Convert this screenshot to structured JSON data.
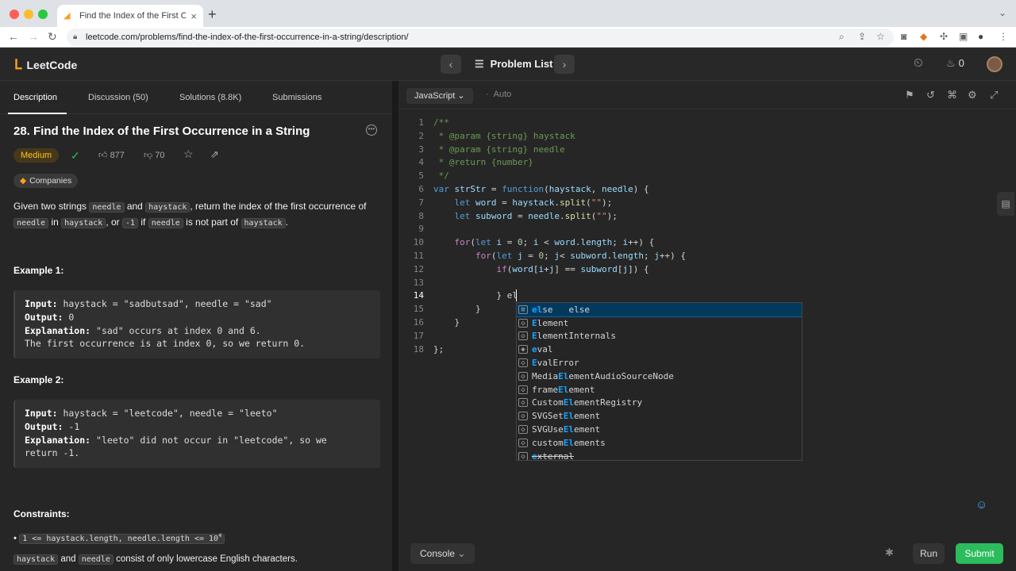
{
  "browser": {
    "tab_title": "Find the Index of the First Occu",
    "url": "leetcode.com/problems/find-the-index-of-the-first-occurrence-in-a-string/description/",
    "traffic_colors": [
      "#ff5f57",
      "#febc2e",
      "#28c840"
    ]
  },
  "nav": {
    "logo": "LeetCode",
    "problem_list": "Problem List",
    "streak": "0"
  },
  "left_tabs": [
    "Description",
    "Discussion (50)",
    "Solutions (8.8K)",
    "Submissions"
  ],
  "problem": {
    "title": "28. Find the Index of the First Occurrence in a String",
    "difficulty": "Medium",
    "likes": "877",
    "dislikes": "70",
    "companies": "Companies",
    "desc": {
      "p1": "Given two strings ",
      "c1": "needle",
      "p2": " and ",
      "c2": "haystack",
      "p3": ", return the index of the first occurrence of",
      "c3": "needle",
      "p4": " in ",
      "c4": "haystack",
      "p5": ", or ",
      "c5": "-1",
      "p6": " if ",
      "c6": "needle",
      "p7": " is not part of ",
      "c7": "haystack",
      "p8": "."
    },
    "example1_heading": "Example 1:",
    "example1": {
      "input_label": "Input:",
      "input": " haystack = \"sadbutsad\", needle = \"sad\"",
      "output_label": "Output:",
      "output": " 0",
      "expl_label": "Explanation:",
      "expl": " \"sad\" occurs at index 0 and 6.",
      "expl2": "The first occurrence is at index 0, so we return 0."
    },
    "example2_heading": "Example 2:",
    "example2": {
      "input_label": "Input:",
      "input": " haystack = \"leetcode\", needle = \"leeto\"",
      "output_label": "Output:",
      "output": " -1",
      "expl_label": "Explanation:",
      "expl": " \"leeto\" did not occur in \"leetcode\", so we",
      "expl2": "return -1."
    },
    "constraints_heading": "Constraints:",
    "constraint1": "1 <= haystack.length, needle.length <= 10",
    "constraint1_sup": "4",
    "constraint2_c1": "haystack",
    "constraint2_mid": " and ",
    "constraint2_c2": "needle",
    "constraint2_rest": " consist of only lowercase English characters."
  },
  "editor": {
    "language": "JavaScript",
    "mode": "Auto",
    "line_numbers": [
      "1",
      "2",
      "3",
      "4",
      "5",
      "6",
      "7",
      "8",
      "9",
      "10",
      "11",
      "12",
      "13",
      "14",
      "15",
      "16",
      "17",
      "18"
    ],
    "lines": [
      "/**",
      " * @param {string} haystack",
      " * @param {string} needle",
      " * @return {number}",
      " */",
      "var strStr = function(haystack, needle) {",
      "    let word = haystack.split(\"\");",
      "    let subword = needle.split(\"\");",
      "",
      "    for(let i = 0; i < word.length; i++) {",
      "        for(let j = 0; j< subword.length; j++) {",
      "            if(word[i+j] == subword[j]) {",
      "",
      "            } el",
      "        }",
      "    }",
      "",
      "};"
    ]
  },
  "suggestions": [
    {
      "pre": "",
      "hl": "el",
      "post": "se",
      "detail": "else",
      "icon": "≡"
    },
    {
      "pre": "",
      "hl": "E",
      "post": "lement",
      "detail": "",
      "icon": "◇"
    },
    {
      "pre": "",
      "hl": "E",
      "post": "lementInternals",
      "detail": "",
      "icon": "◇"
    },
    {
      "pre": "",
      "hl": "e",
      "post": "val",
      "detail": "",
      "icon": "◈"
    },
    {
      "pre": "",
      "hl": "E",
      "post": "valError",
      "detail": "",
      "icon": "◇"
    },
    {
      "pre": "Media",
      "hl": "El",
      "post": "ementAudioSourceNode",
      "detail": "",
      "icon": "◇"
    },
    {
      "pre": "frame",
      "hl": "El",
      "post": "ement",
      "detail": "",
      "icon": "◇"
    },
    {
      "pre": "Custom",
      "hl": "El",
      "post": "ementRegistry",
      "detail": "",
      "icon": "◇"
    },
    {
      "pre": "SVGSet",
      "hl": "El",
      "post": "ement",
      "detail": "",
      "icon": "◇"
    },
    {
      "pre": "SVGUse",
      "hl": "El",
      "post": "ement",
      "detail": "",
      "icon": "◇"
    },
    {
      "pre": "custom",
      "hl": "El",
      "post": "ements",
      "detail": "",
      "icon": "◇"
    },
    {
      "pre": "",
      "hl": "e",
      "post": "xternal",
      "detail": "",
      "icon": "◇"
    }
  ],
  "bottom": {
    "console": "Console",
    "run": "Run",
    "submit": "Submit"
  },
  "colors": {
    "accent_orange": "#ffa116",
    "submit_green": "#2cbb5d",
    "medium_yellow": "#ffc01e"
  }
}
